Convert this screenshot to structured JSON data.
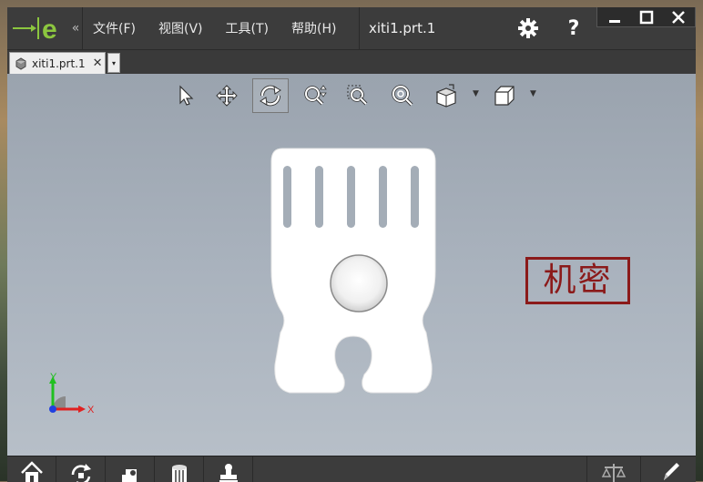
{
  "app": {
    "logo_letter": "e",
    "collapse_glyph": "«"
  },
  "menu": [
    {
      "label": "文件(F)"
    },
    {
      "label": "视图(V)"
    },
    {
      "label": "工具(T)"
    },
    {
      "label": "帮助(H)"
    }
  ],
  "document": {
    "title": "xiti1.prt.1"
  },
  "title_actions": {
    "settings_icon": "gear-icon",
    "help_label": "?"
  },
  "window_controls": {
    "minimize": "—",
    "maximize": "☐",
    "close": "✕"
  },
  "tabs": [
    {
      "label": "xiti1.prt.1",
      "close": "✕",
      "active": true
    }
  ],
  "tab_dropdown": "▾",
  "view_toolbar": [
    {
      "name": "select-icon"
    },
    {
      "name": "pan-icon"
    },
    {
      "name": "rotate-icon",
      "active": true
    },
    {
      "name": "zoom-icon"
    },
    {
      "name": "zoom-area-icon"
    },
    {
      "name": "fit-zoom-icon"
    },
    {
      "name": "display-style-icon",
      "dropdown": true
    },
    {
      "name": "view-orientation-icon",
      "dropdown": true
    }
  ],
  "stamp": {
    "text": "机密",
    "color": "#8b1a1a"
  },
  "triad": {
    "x_label": "X",
    "y_label": "Y",
    "x_color": "#e02020",
    "y_color": "#20c020",
    "z_color": "#2040e0"
  },
  "bottom_toolbar": [
    {
      "name": "home-icon"
    },
    {
      "name": "refresh-icon"
    },
    {
      "name": "part-icon"
    },
    {
      "name": "database-icon"
    },
    {
      "name": "stamp-tool-icon"
    },
    {
      "name": "balance-icon"
    },
    {
      "name": "pencil-icon"
    }
  ],
  "colors": {
    "accent": "#8cc63f",
    "titlebar": "#3c3c3c"
  }
}
